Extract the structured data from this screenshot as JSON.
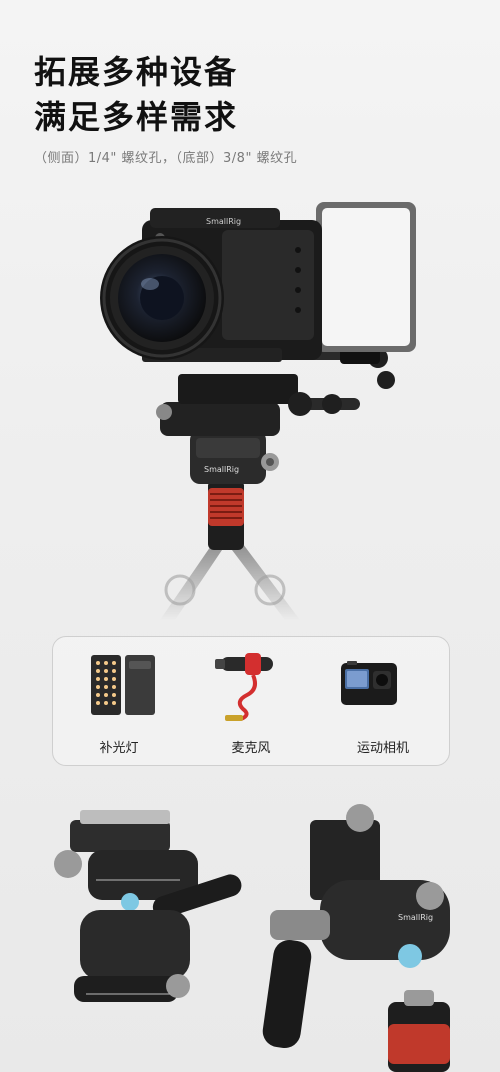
{
  "headline": {
    "line1": "拓展多种设备",
    "line2": "满足多样需求"
  },
  "subtitle": "（侧面）1/4\" 螺纹孔，（底部）3/8\" 螺纹孔",
  "brand_mark": "SmallRig",
  "accessories": [
    {
      "label": "补光灯",
      "icon": "fill-light-icon"
    },
    {
      "label": "麦克风",
      "icon": "microphone-icon"
    },
    {
      "label": "运动相机",
      "icon": "action-camera-icon"
    }
  ]
}
